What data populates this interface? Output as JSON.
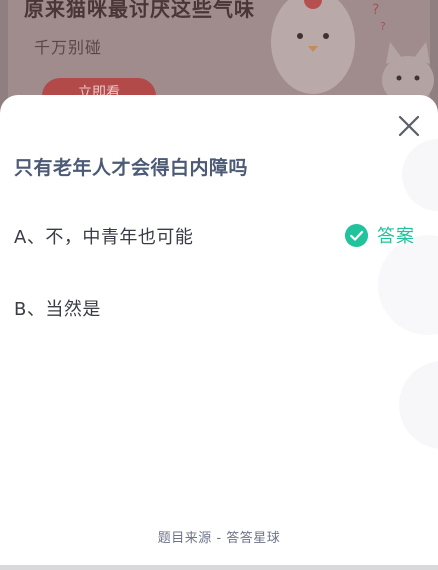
{
  "banner": {
    "title": "原来猫咪最讨厌这些气味",
    "subtitle": "千万别碰",
    "button_label": "立即看"
  },
  "quiz": {
    "question": "只有老年人才会得白内障吗",
    "options": [
      {
        "label": "A、不，中青年也可能",
        "is_answer": true
      },
      {
        "label": "B、当然是",
        "is_answer": false
      }
    ],
    "answer_tag": "答案",
    "source": "题目来源 - 答答星球"
  },
  "colors": {
    "accent_green": "#21c39c",
    "question_color": "#4c5a76",
    "overlay": "#8f7f80"
  },
  "icons": {
    "close": "close-icon",
    "check": "check-circle-icon"
  }
}
